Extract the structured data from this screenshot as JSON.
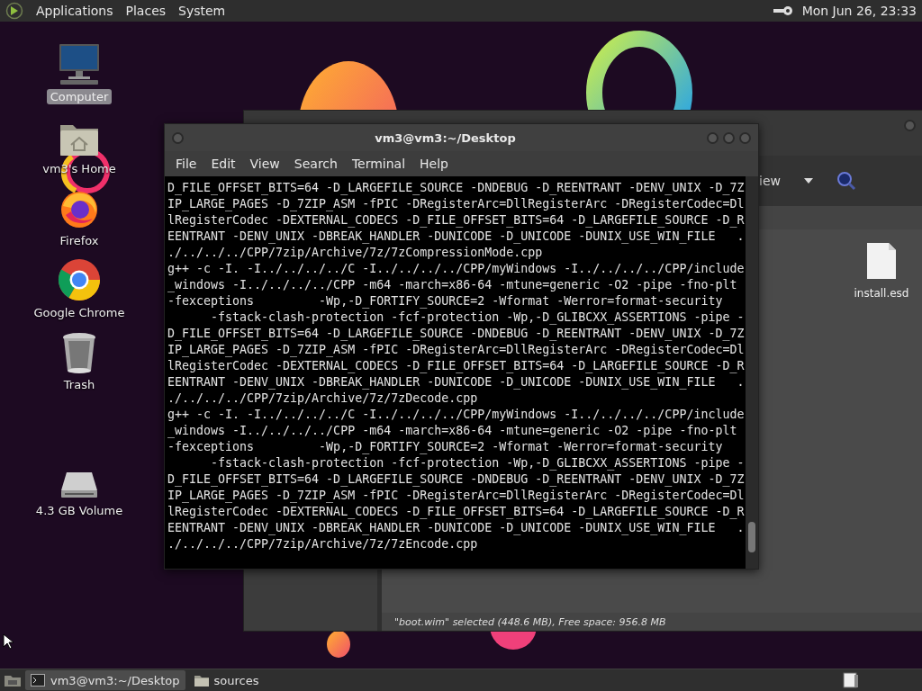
{
  "top_panel": {
    "menus": [
      "Applications",
      "Places",
      "System"
    ],
    "clock": "Mon Jun 26, 23:33"
  },
  "desktop_icons": [
    {
      "kind": "computer",
      "label": "Computer",
      "selected": true
    },
    {
      "kind": "home",
      "label": "vm3's Home",
      "selected": false
    },
    {
      "kind": "firefox",
      "label": "Firefox",
      "selected": false
    },
    {
      "kind": "chrome",
      "label": "Google Chrome",
      "selected": false
    },
    {
      "kind": "trash",
      "label": "Trash",
      "selected": false
    },
    {
      "kind": "drive",
      "label": "4.3 GB Volume",
      "selected": false
    }
  ],
  "file_manager": {
    "toolbar_label": "iew",
    "files": [
      {
        "kind": "document",
        "name": "install.esd"
      }
    ],
    "status_bar": "\"boot.wim\" selected (448.6 MB), Free space: 956.8 MB"
  },
  "terminal": {
    "title": "vm3@vm3:~/Desktop",
    "menus": [
      "File",
      "Edit",
      "View",
      "Search",
      "Terminal",
      "Help"
    ],
    "lines": [
      "D_FILE_OFFSET_BITS=64 -D_LARGEFILE_SOURCE -DNDEBUG -D_REENTRANT -DENV_UNIX -D_7Z",
      "IP_LARGE_PAGES -D_7ZIP_ASM -fPIC -DRegisterArc=DllRegisterArc -DRegisterCodec=Dl",
      "lRegisterCodec -DEXTERNAL_CODECS -D_FILE_OFFSET_BITS=64 -D_LARGEFILE_SOURCE -D_R",
      "EENTRANT -DENV_UNIX -DBREAK_HANDLER -DUNICODE -D_UNICODE -DUNIX_USE_WIN_FILE   .",
      "./../../../CPP/7zip/Archive/7z/7zCompressionMode.cpp",
      "g++ -c -I. -I../../../../C -I../../../../CPP/myWindows -I../../../../CPP/include",
      "_windows -I../../../../CPP -m64 -march=x86-64 -mtune=generic -O2 -pipe -fno-plt",
      "-fexceptions         -Wp,-D_FORTIFY_SOURCE=2 -Wformat -Werror=format-security",
      "      -fstack-clash-protection -fcf-protection -Wp,-D_GLIBCXX_ASSERTIONS -pipe -",
      "D_FILE_OFFSET_BITS=64 -D_LARGEFILE_SOURCE -DNDEBUG -D_REENTRANT -DENV_UNIX -D_7Z",
      "IP_LARGE_PAGES -D_7ZIP_ASM -fPIC -DRegisterArc=DllRegisterArc -DRegisterCodec=Dl",
      "lRegisterCodec -DEXTERNAL_CODECS -D_FILE_OFFSET_BITS=64 -D_LARGEFILE_SOURCE -D_R",
      "EENTRANT -DENV_UNIX -DBREAK_HANDLER -DUNICODE -D_UNICODE -DUNIX_USE_WIN_FILE   .",
      "./../../../CPP/7zip/Archive/7z/7zDecode.cpp",
      "g++ -c -I. -I../../../../C -I../../../../CPP/myWindows -I../../../../CPP/include",
      "_windows -I../../../../CPP -m64 -march=x86-64 -mtune=generic -O2 -pipe -fno-plt",
      "-fexceptions         -Wp,-D_FORTIFY_SOURCE=2 -Wformat -Werror=format-security",
      "      -fstack-clash-protection -fcf-protection -Wp,-D_GLIBCXX_ASSERTIONS -pipe -",
      "D_FILE_OFFSET_BITS=64 -D_LARGEFILE_SOURCE -DNDEBUG -D_REENTRANT -DENV_UNIX -D_7Z",
      "IP_LARGE_PAGES -D_7ZIP_ASM -fPIC -DRegisterArc=DllRegisterArc -DRegisterCodec=Dl",
      "lRegisterCodec -DEXTERNAL_CODECS -D_FILE_OFFSET_BITS=64 -D_LARGEFILE_SOURCE -D_R",
      "EENTRANT -DENV_UNIX -DBREAK_HANDLER -DUNICODE -D_UNICODE -DUNIX_USE_WIN_FILE   .",
      "./../../../CPP/7zip/Archive/7z/7zEncode.cpp"
    ]
  },
  "taskbar": {
    "tasks": [
      {
        "kind": "terminal",
        "label": "vm3@vm3:~/Desktop",
        "selected": true
      },
      {
        "kind": "folder",
        "label": "sources",
        "selected": false
      }
    ]
  }
}
